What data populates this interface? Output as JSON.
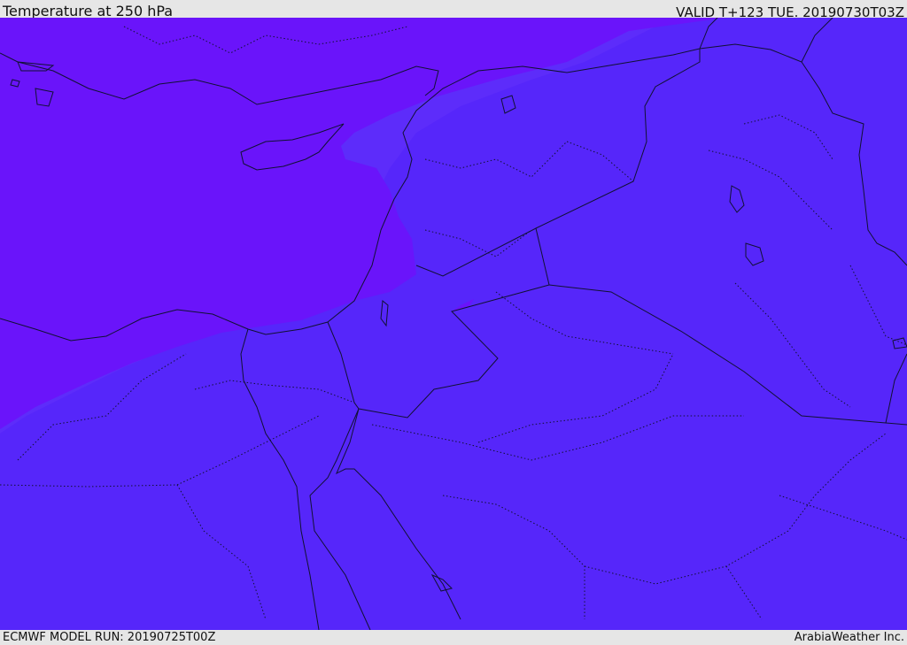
{
  "header": {
    "title": "Temperature at 250 hPa",
    "valid": "VALID T+123 TUE. 20190730T03Z"
  },
  "footer": {
    "model_run": "ECMWF MODEL RUN: 20190725T00Z",
    "credit": "ArabiaWeather Inc."
  },
  "colors": {
    "cold_zone": "#6a14fa",
    "main_zone": "#5626fa",
    "transition_zone": "#5d2cfa",
    "frame": "#e6e6e6",
    "border_line": "#111133"
  }
}
